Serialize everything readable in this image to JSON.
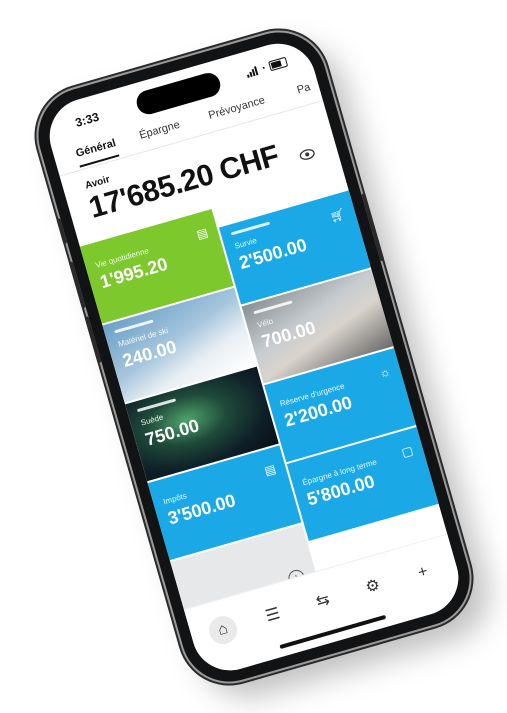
{
  "status": {
    "time": "3:33"
  },
  "tabs": [
    {
      "label": "Général",
      "active": true
    },
    {
      "label": "Épargne",
      "active": false
    },
    {
      "label": "Prévoyance",
      "active": false
    },
    {
      "label": "Pa",
      "active": false
    }
  ],
  "account": {
    "label": "Avoir",
    "balance": "17'685.20 CHF"
  },
  "tiles": [
    {
      "name": "Vie quotidienne",
      "amount": "1'995.20",
      "icon": "receipt-icon",
      "color": "#7cc82d"
    },
    {
      "name": "Survie",
      "amount": "2'500.00",
      "icon": "cart-icon",
      "color": "#1aa9e6"
    },
    {
      "name": "Matériel de ski",
      "amount": "240.00",
      "icon": "ski-photo",
      "color": ""
    },
    {
      "name": "Vélo",
      "amount": "700.00",
      "icon": "bike-photo",
      "color": ""
    },
    {
      "name": "Suède",
      "amount": "750.00",
      "icon": "aurora-photo",
      "color": ""
    },
    {
      "name": "Réserve d'urgence",
      "amount": "2'200.00",
      "icon": "sun-icon",
      "color": "#1aa9e6"
    },
    {
      "name": "Impôts",
      "amount": "3'500.00",
      "icon": "receipt-icon",
      "color": "#1aa9e6"
    },
    {
      "name": "Épargne à long terme",
      "amount": "5'800.00",
      "icon": "piggy-bank-icon",
      "color": "#1aa9e6"
    }
  ],
  "add_tile": {
    "icon": "plus-circle-icon",
    "symbol": "+"
  },
  "nav": [
    {
      "icon": "home-icon",
      "symbol": "⌂"
    },
    {
      "icon": "list-icon",
      "symbol": "☰"
    },
    {
      "icon": "transfer-icon",
      "symbol": "⇆"
    },
    {
      "icon": "settings-icon",
      "symbol": "⚙"
    },
    {
      "icon": "plus-icon",
      "symbol": "+"
    }
  ]
}
